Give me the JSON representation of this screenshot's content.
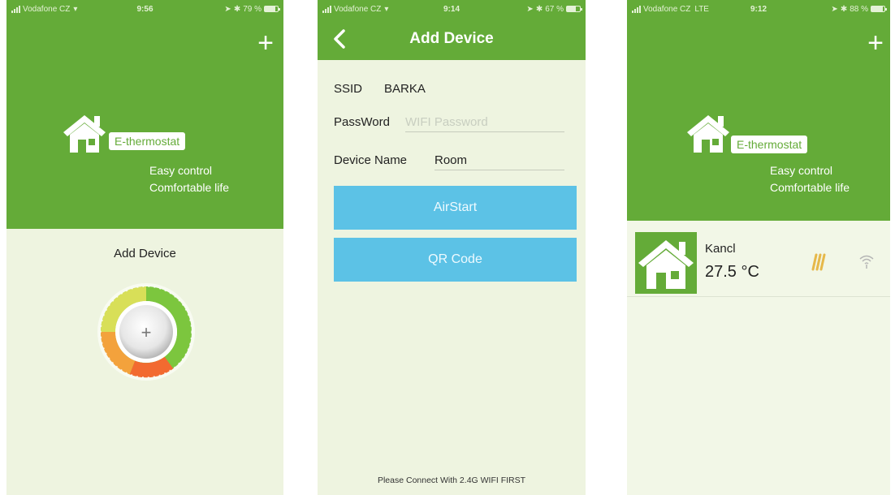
{
  "colors": {
    "brand_green": "#64ab38",
    "background": "#eef4e0",
    "button_blue": "#5cc2e6"
  },
  "screen1": {
    "status": {
      "carrier": "Vodafone CZ",
      "time": "9:56",
      "battery": "79 %",
      "battery_level": 0.79
    },
    "add_icon": "plus-icon",
    "brand": "E-thermostat",
    "tagline1": "Easy control",
    "tagline2": "Comfortable life",
    "add_device_label": "Add Device",
    "dial_icon": "thermostat-dial-add-icon"
  },
  "screen2": {
    "status": {
      "carrier": "Vodafone CZ",
      "time": "9:14",
      "battery": "67 %",
      "battery_level": 0.67
    },
    "back_icon": "chevron-left-icon",
    "title": "Add Device",
    "ssid_label": "SSID",
    "ssid_value": "BARKA",
    "password_label": "PassWord",
    "password_placeholder": "WIFI Password",
    "password_value": "",
    "device_name_label": "Device Name",
    "device_name_value": "Room",
    "airstart_label": "AirStart",
    "qr_label": "QR Code",
    "footnote": "Please Connect With 2.4G WIFI FIRST"
  },
  "screen3": {
    "status": {
      "carrier": "Vodafone CZ",
      "network": "LTE",
      "time": "9:12",
      "battery": "88 %",
      "battery_level": 0.88
    },
    "add_icon": "plus-icon",
    "brand": "E-thermostat",
    "tagline1": "Easy control",
    "tagline2": "Comfortable life",
    "device": {
      "name": "Kancl",
      "temperature": "27.5 °C",
      "thumb_icon": "house-icon",
      "heating_icon": "heating-icon",
      "wifi_icon": "wifi-icon"
    }
  }
}
